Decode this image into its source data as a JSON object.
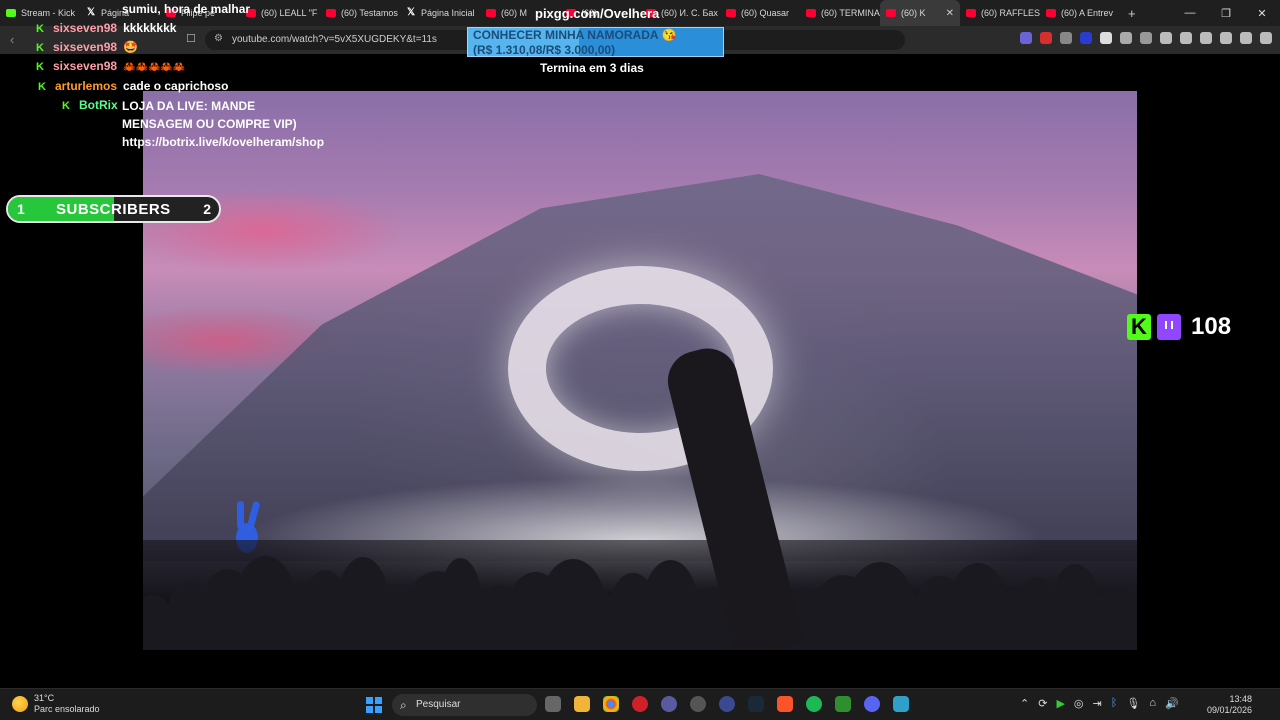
{
  "browser": {
    "tabs": [
      {
        "icon": "kick",
        "label": "Stream - Kick"
      },
      {
        "icon": "x",
        "label": "Página"
      },
      {
        "icon": "youtube",
        "label": "Filipe pé"
      },
      {
        "icon": "youtube",
        "label": "(60) LEALL \"F"
      },
      {
        "icon": "youtube",
        "label": "(60) Testamos"
      },
      {
        "icon": "x",
        "label": "Página Inicial"
      },
      {
        "icon": "youtube",
        "label": "(60) M"
      },
      {
        "icon": "youtube",
        "label": "(60)"
      },
      {
        "icon": "youtube",
        "label": "(60) И. С. Бах"
      },
      {
        "icon": "youtube",
        "label": "(60) Quasar"
      },
      {
        "icon": "youtube",
        "label": "(60) TERMINA"
      },
      {
        "icon": "youtube",
        "label": "(60) K",
        "active": true
      },
      {
        "icon": "youtube",
        "label": "(60) RAFFLES"
      },
      {
        "icon": "youtube",
        "label": "(60) A Entrev"
      }
    ],
    "new_tab": "+",
    "window_controls": [
      "—",
      "❐",
      "✕"
    ],
    "url": "youtube.com/watch?v=5vX5XUGDEKY&t=11s"
  },
  "overlay": {
    "top_message": "sumiu, hora de malhar",
    "chat": [
      {
        "user": "sixseven98",
        "user_color": "#ff9ea8",
        "message": "kkkkkkkk"
      },
      {
        "user": "sixseven98",
        "user_color": "#ff9ea8",
        "message": "🤩"
      },
      {
        "user": "sixseven98",
        "user_color": "#ff9ea8",
        "message": "🦀🦀🦀🦀🦀"
      },
      {
        "user": "arturlemos",
        "user_color": "#ff9a2e",
        "message": "cade o caprichoso"
      },
      {
        "user": "BotRix",
        "user_color": "#57ff8a",
        "message": "LOJA DA LIVE: MANDE MENSAGEM OU COMPRE VIP) https://botrix.live/k/ovelheram/shop"
      }
    ],
    "sub_goal": {
      "current": "1",
      "label": "SUBSCRIBERS",
      "target": "2",
      "progress_fraction": 0.5
    },
    "pix": {
      "title": "pixgg.com/Ovelhera",
      "goal_title": "CONHECER MINHA NAMORADA 😘",
      "goal_amount": "(R$ 1.310,08/R$ 3.000,00)",
      "progress_fraction": 0.437,
      "ends": "Termina em 3 dias"
    },
    "viewers": "108"
  },
  "taskbar": {
    "weather_temp": "31°C",
    "weather_desc": "Parc ensolarado",
    "search_placeholder": "Pesquisar",
    "time": "13:48",
    "date": "09/01/2026"
  }
}
